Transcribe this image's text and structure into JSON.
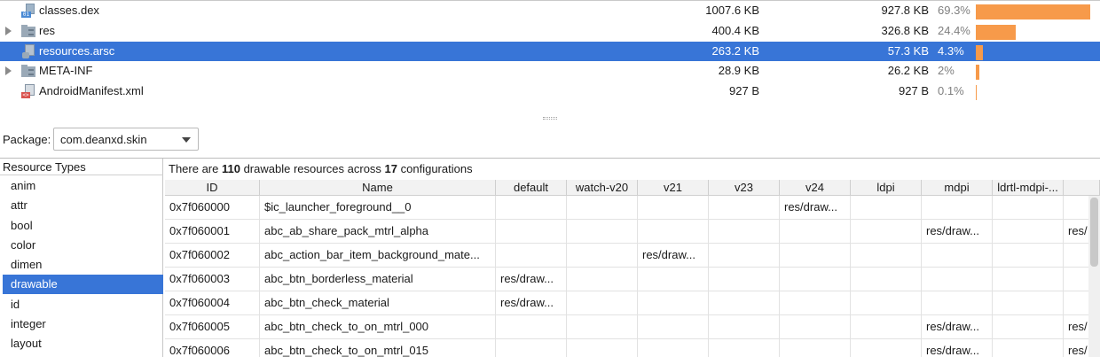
{
  "files": [
    {
      "name": "classes.dex",
      "raw_size": "1007.6 KB",
      "download_size": "927.8 KB",
      "percent": "69.3%",
      "share": 0.693,
      "kind": "dex",
      "expandable": false,
      "selected": false
    },
    {
      "name": "res",
      "raw_size": "400.4 KB",
      "download_size": "326.8 KB",
      "percent": "24.4%",
      "share": 0.244,
      "kind": "folder",
      "expandable": true,
      "selected": false
    },
    {
      "name": "resources.arsc",
      "raw_size": "263.2 KB",
      "download_size": "57.3 KB",
      "percent": "4.3%",
      "share": 0.043,
      "kind": "arsc",
      "expandable": false,
      "selected": true
    },
    {
      "name": "META-INF",
      "raw_size": "28.9 KB",
      "download_size": "26.2 KB",
      "percent": "2%",
      "share": 0.02,
      "kind": "folder",
      "expandable": true,
      "selected": false
    },
    {
      "name": "AndroidManifest.xml",
      "raw_size": "927 B",
      "download_size": "927 B",
      "percent": "0.1%",
      "share": 0.001,
      "kind": "xml",
      "expandable": false,
      "selected": false
    }
  ],
  "colors": {
    "selection": "#3875d7",
    "size_bar": "#f79a4a"
  },
  "package": {
    "label": "Package:",
    "value": "com.deanxd.skin"
  },
  "resource_types": {
    "header": "Resource Types",
    "items": [
      "anim",
      "attr",
      "bool",
      "color",
      "dimen",
      "drawable",
      "id",
      "integer",
      "layout"
    ],
    "selected": "drawable"
  },
  "summary": {
    "prefix": "There are ",
    "count": "110",
    "middle": " drawable resources across ",
    "configs": "17",
    "suffix": " configurations"
  },
  "table": {
    "columns": [
      "ID",
      "Name",
      "default",
      "watch-v20",
      "v21",
      "v23",
      "v24",
      "ldpi",
      "mdpi",
      "ldrtl-mdpi-...",
      ""
    ],
    "rows": [
      [
        "0x7f060000",
        "$ic_launcher_foreground__0",
        "",
        "",
        "",
        "",
        "res/draw...",
        "",
        "",
        "",
        ""
      ],
      [
        "0x7f060001",
        "abc_ab_share_pack_mtrl_alpha",
        "",
        "",
        "",
        "",
        "",
        "",
        "res/draw...",
        "",
        "res/"
      ],
      [
        "0x7f060002",
        "abc_action_bar_item_background_mate...",
        "",
        "",
        "res/draw...",
        "",
        "",
        "",
        "",
        "",
        ""
      ],
      [
        "0x7f060003",
        "abc_btn_borderless_material",
        "res/draw...",
        "",
        "",
        "",
        "",
        "",
        "",
        "",
        ""
      ],
      [
        "0x7f060004",
        "abc_btn_check_material",
        "res/draw...",
        "",
        "",
        "",
        "",
        "",
        "",
        "",
        ""
      ],
      [
        "0x7f060005",
        "abc_btn_check_to_on_mtrl_000",
        "",
        "",
        "",
        "",
        "",
        "",
        "res/draw...",
        "",
        "res/"
      ],
      [
        "0x7f060006",
        "abc_btn_check_to_on_mtrl_015",
        "",
        "",
        "",
        "",
        "",
        "",
        "res/draw...",
        "",
        "res/"
      ]
    ]
  }
}
